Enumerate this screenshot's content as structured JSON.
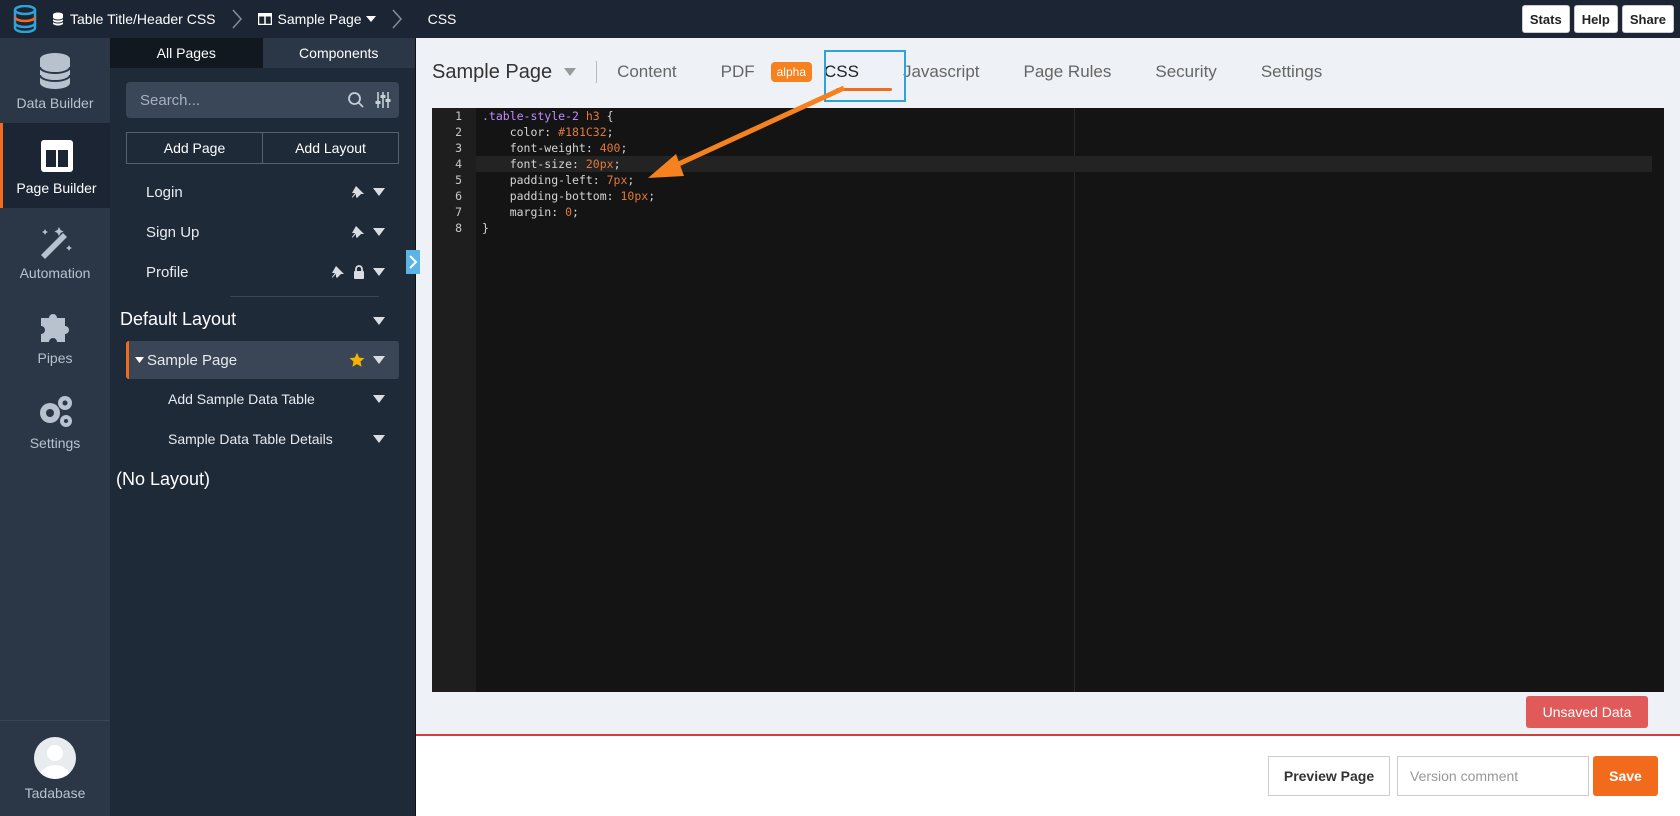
{
  "topbar": {
    "breadcrumb": [
      "Table Title/Header CSS",
      "Sample Page",
      "CSS"
    ],
    "buttons": [
      "Stats",
      "Help",
      "Share"
    ]
  },
  "rail": {
    "items": [
      {
        "label": "Data Builder",
        "icon": "database-icon"
      },
      {
        "label": "Page Builder",
        "icon": "page-builder-icon",
        "active": true
      },
      {
        "label": "Automation",
        "icon": "magic-wand-icon"
      },
      {
        "label": "Pipes",
        "icon": "puzzle-icon"
      },
      {
        "label": "Settings",
        "icon": "gears-icon"
      }
    ],
    "user": "Tadabase"
  },
  "panel": {
    "tabs": [
      "All Pages",
      "Components"
    ],
    "search_placeholder": "Search...",
    "buttons": [
      "Add Page",
      "Add Layout"
    ],
    "pages": [
      {
        "label": "Login",
        "pinned": true
      },
      {
        "label": "Sign Up",
        "pinned": true
      },
      {
        "label": "Profile",
        "pinned": true,
        "locked": true
      }
    ],
    "layout_title": "Default Layout",
    "layout_pages": [
      {
        "label": "Sample Page",
        "selected": true,
        "starred": true
      },
      {
        "label": "Add Sample Data Table"
      },
      {
        "label": "Sample Data Table Details"
      }
    ],
    "no_layout": "(No Layout)"
  },
  "main": {
    "page_title": "Sample Page",
    "tabs": [
      "Content",
      "PDF",
      "CSS",
      "Javascript",
      "Page Rules",
      "Security",
      "Settings"
    ],
    "active_tab": "CSS",
    "alpha_badge": "alpha",
    "line_numbers": [
      "1",
      "2",
      "3",
      "4",
      "5",
      "6",
      "7",
      "8"
    ],
    "code": [
      [
        {
          "t": ".table-style-2 ",
          "c": "sel"
        },
        {
          "t": "h3",
          "c": "tag"
        },
        {
          "t": " {",
          "c": "prop"
        }
      ],
      [
        {
          "t": "    color: ",
          "c": "prop"
        },
        {
          "t": "#181C32",
          "c": "val"
        },
        {
          "t": ";",
          "c": "prop"
        }
      ],
      [
        {
          "t": "    font-weight: ",
          "c": "prop"
        },
        {
          "t": "400",
          "c": "val"
        },
        {
          "t": ";",
          "c": "prop"
        }
      ],
      [
        {
          "t": "    font-size: ",
          "c": "prop"
        },
        {
          "t": "20px",
          "c": "val"
        },
        {
          "t": ";",
          "c": "prop"
        }
      ],
      [
        {
          "t": "    padding-left: ",
          "c": "prop"
        },
        {
          "t": "7px",
          "c": "val"
        },
        {
          "t": ";",
          "c": "prop"
        }
      ],
      [
        {
          "t": "    padding-bottom: ",
          "c": "prop"
        },
        {
          "t": "10px",
          "c": "val"
        },
        {
          "t": ";",
          "c": "prop"
        }
      ],
      [
        {
          "t": "    margin: ",
          "c": "prop"
        },
        {
          "t": "0",
          "c": "val"
        },
        {
          "t": ";",
          "c": "prop"
        }
      ],
      [
        {
          "t": "}",
          "c": "prop"
        }
      ]
    ],
    "unsaved_label": "Unsaved Data",
    "preview_label": "Preview Page",
    "version_placeholder": "Version comment",
    "save_label": "Save"
  },
  "colors": {
    "accent": "#f26b1d",
    "highlight_box": "#2ea3d9",
    "unsaved": "#e05a5a"
  }
}
